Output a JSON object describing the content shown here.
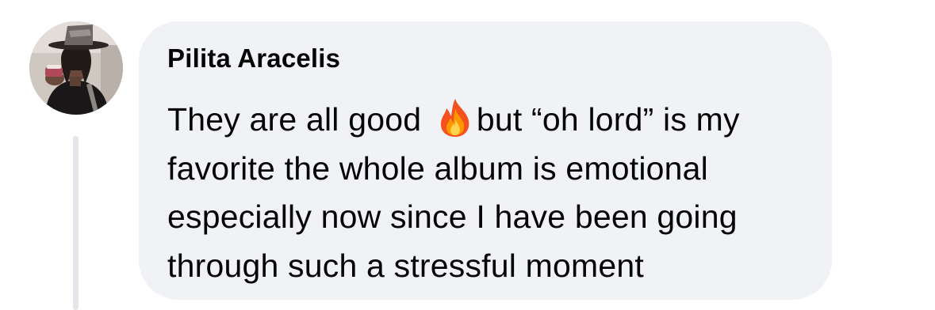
{
  "comment": {
    "author": "Pilita Aracelis",
    "avatar_icon": "profile-photo-avatar",
    "text": {
      "line1_before": "They are all good ",
      "emoji_icon": "fire-emoji-icon",
      "line1_after": "but “oh lord” is my",
      "line2": "favorite the whole album is emotional",
      "line3": "especially now since I have been going",
      "line4": "through such a stressful moment"
    }
  },
  "colors": {
    "bubble_background": "#f0f2f5",
    "text": "#050505",
    "thread_line": "#e4e6eb"
  }
}
